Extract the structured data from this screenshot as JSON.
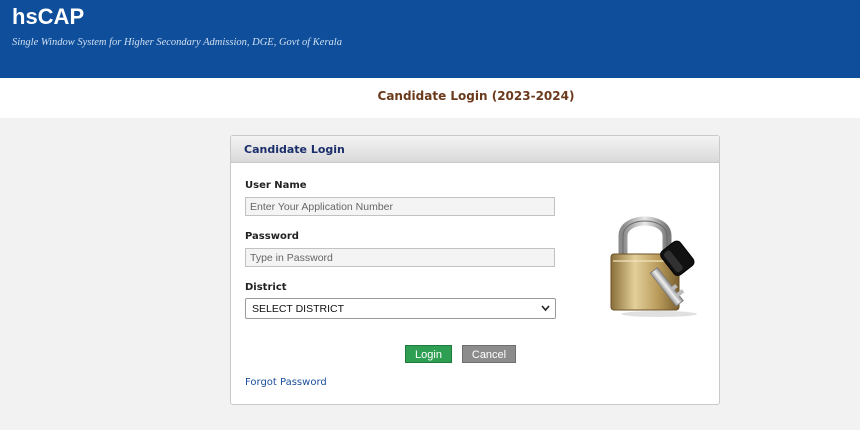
{
  "header": {
    "logo": "hsCAP",
    "tagline": "Single Window System for Higher Secondary Admission, DGE, Govt of Kerala"
  },
  "page": {
    "title": "Candidate Login (2023-2024)"
  },
  "login_card": {
    "title": "Candidate Login",
    "username_label": "User Name",
    "username_placeholder": "Enter Your Application Number",
    "password_label": "Password",
    "password_placeholder": "Type in Password",
    "district_label": "District",
    "district_selected": "SELECT DISTRICT",
    "login_label": "Login",
    "cancel_label": "Cancel",
    "forgot_label": "Forgot Password"
  },
  "icons": {
    "lock": "padlock-with-key-icon",
    "select_arrow": "chevron-down-icon"
  },
  "colors": {
    "header_bg": "#0e4e9a",
    "login_button": "#2e9e52",
    "cancel_button": "#8c8c8c",
    "title_text": "#6b3a1c"
  }
}
